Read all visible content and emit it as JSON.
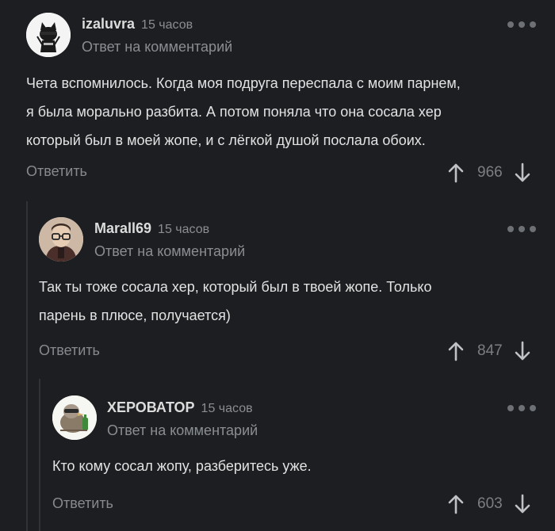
{
  "comments": [
    {
      "author": "izaluvra",
      "time": "15 часов",
      "reply_to": "Ответ на комментарий",
      "lines": [
        "Чета вспомнилось. Когда моя подруга переспала с моим парнем,",
        "я была морально разбита. А потом поняла что она сосала хер",
        "который был в моей жопе, и с лёгкой душой послала обоих."
      ],
      "reply_label": "Ответить",
      "score": "966"
    },
    {
      "author": "Marall69",
      "time": "15 часов",
      "reply_to": "Ответ на комментарий",
      "lines": [
        "Так ты тоже сосала хер, который был в твоей жопе. Только",
        "парень в плюсе, получается)"
      ],
      "reply_label": "Ответить",
      "score": "847"
    },
    {
      "author": "ХЕРОВАТОР",
      "time": "15 часов",
      "reply_to": "Ответ на комментарий",
      "lines": [
        "Кто кому сосал жопу, разберитесь уже."
      ],
      "reply_label": "Ответить",
      "score": "603"
    }
  ],
  "icons": {
    "more": "more-dots-icon",
    "upvote": "arrow-up-icon",
    "downvote": "arrow-down-icon"
  },
  "colors": {
    "background": "#1c1e21",
    "muted_text": "#8a8d92",
    "thread_line": "#303236"
  }
}
